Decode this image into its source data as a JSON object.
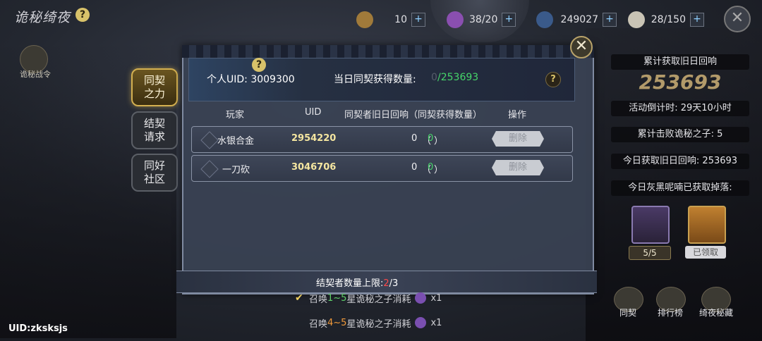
{
  "header": {
    "title": "诡秘绮夜",
    "help": "?",
    "resources": [
      {
        "icon": "potion-icon",
        "value": "10"
      },
      {
        "icon": "flask-icon",
        "value": "38/20"
      },
      {
        "icon": "wand-icon",
        "value": "249027"
      },
      {
        "icon": "feather-icon",
        "value": "28/150"
      }
    ],
    "plus": "+",
    "close": "✕"
  },
  "battle_pass": {
    "label": "诡秘战令"
  },
  "tabs": [
    {
      "label": "同契\n之力",
      "active": true
    },
    {
      "label": "结契\n请求",
      "active": false
    },
    {
      "label": "同好\n社区",
      "active": false
    }
  ],
  "dialog": {
    "close": "✕",
    "help": "?",
    "uid_label": "个人UID: 3009300",
    "today_label": "当日同契获得数量:",
    "today_zero": "0",
    "today_value": "/253693",
    "columns": [
      "玩家",
      "UID",
      "同契者旧日回响（同契获得数量）",
      "操作"
    ],
    "rows": [
      {
        "player": "水银合金",
        "uid": "2954220",
        "echo": "0",
        "gain": "0",
        "action": "删除"
      },
      {
        "player": "一刀砍",
        "uid": "3046706",
        "echo": "0",
        "gain": "0",
        "action": "删除"
      }
    ],
    "footer_prefix": "结契者数量上限:",
    "footer_current": "2",
    "footer_suffix": "/3"
  },
  "summons": [
    {
      "prefix": "召唤",
      "range": "1~5",
      "suffix": "星诡秘之子消耗",
      "count": "x1",
      "checked": true
    },
    {
      "prefix": "召唤",
      "range": "4~5",
      "suffix": "星诡秘之子消耗",
      "count": "x1",
      "checked": false
    }
  ],
  "user_uid": "UID:zksksjs",
  "right_panel": {
    "total_label": "累计获取旧日回响",
    "total_value": "253693",
    "countdown": "活动倒计时: 29天10小时",
    "defeated": "累计击败诡秘之子: 5",
    "today_echo": "今日获取旧日回响: 253693",
    "today_drops": "今日灰黑呢喃已获取掉落:",
    "chests": [
      {
        "label": "5/5"
      },
      {
        "label": "已领取"
      }
    ],
    "bottom_buttons": [
      {
        "label": "同契",
        "icon": "link-icon"
      },
      {
        "label": "排行榜",
        "icon": "ranking-icon"
      },
      {
        "label": "绮夜秘藏",
        "icon": "treasure-icon"
      }
    ]
  },
  "colors": {
    "accent_gold": "#d4b050",
    "green": "#46d66a",
    "red": "#ff4a4a"
  }
}
